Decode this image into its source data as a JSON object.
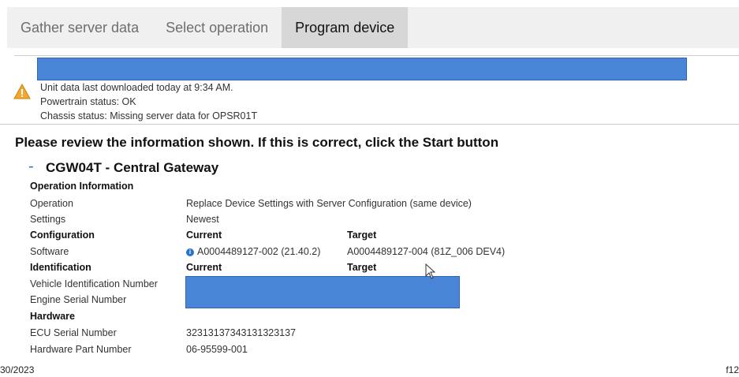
{
  "tabs": [
    {
      "label": "Gather server data",
      "active": false
    },
    {
      "label": "Select operation",
      "active": false
    },
    {
      "label": "Program device",
      "active": true
    }
  ],
  "status": {
    "line1": "Unit data last downloaded today at 9:34 AM.",
    "line2": "Powertrain status: OK",
    "line3": "Chassis status: Missing server data for OPSR01T"
  },
  "review_message": "Please review the information shown. If this is correct, click the Start button",
  "device": {
    "collapse_symbol": "-",
    "title": "CGW04T - Central Gateway",
    "operation_info_heading": "Operation Information",
    "operation_label": "Operation",
    "operation_value": "Replace Device Settings with Server Configuration (same device)",
    "settings_label": "Settings",
    "settings_value": "Newest",
    "configuration_heading": "Configuration",
    "current_header": "Current",
    "target_header": "Target",
    "software_label": "Software",
    "software_current": "A0004489127-002 (21.40.2)",
    "software_target": "A0004489127-004 (81Z_006 DEV4)",
    "identification_heading": "Identification",
    "vin_label": "Vehicle Identification Number",
    "engine_serial_label": "Engine Serial Number",
    "hardware_heading": "Hardware",
    "ecu_serial_label": "ECU Serial Number",
    "ecu_serial_value": "32313137343131323137",
    "hw_part_label": "Hardware Part Number",
    "hw_part_value": "06-95599-001"
  },
  "footer": {
    "left": "30/2023",
    "right": "f12"
  },
  "colors": {
    "redaction": "#4a86d8",
    "warning": "#f0a830",
    "info": "#2b73c5",
    "tab_active": "#d7d7d7",
    "tab_bar": "#f0f0f0"
  },
  "icons": {
    "warning": "warning-triangle-icon",
    "info": "info-icon",
    "cursor": "mouse-cursor-icon"
  }
}
